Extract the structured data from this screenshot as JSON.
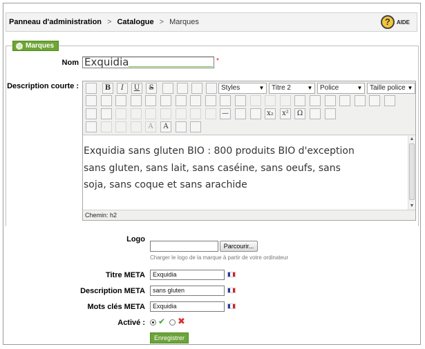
{
  "breadcrumb": {
    "items": [
      "Panneau d'administration",
      "Catalogue",
      "Marques"
    ],
    "separator": ">"
  },
  "help": {
    "label": "AIDE",
    "icon": "question-mark-icon"
  },
  "fieldset": {
    "legend": "Marques",
    "legend_icon": "gear-icon",
    "legend_color": "#6fa535"
  },
  "form": {
    "name": {
      "label": "Nom",
      "value": "Exquidia",
      "required_mark": "*"
    },
    "short_description": {
      "label": "Description courte :",
      "content": "Exquidia sans gluten BIO :  800 produits BIO d'exception sans gluten, sans lait, sans caséine, sans oeufs, sans soja, sans coque et sans arachide",
      "path_label": "Chemin: h2"
    },
    "toolbar": {
      "row1": [
        "new-document-icon",
        "bold-icon",
        "italic-icon",
        "underline-icon",
        "strikethrough-icon",
        "align-left-icon",
        "align-center-icon",
        "align-right-icon",
        "align-justify-icon"
      ],
      "row1_glyphs": [
        "",
        "B",
        "I",
        "U",
        "S",
        "",
        "",
        "",
        ""
      ],
      "dropdowns": [
        {
          "name": "styles",
          "value": "Styles"
        },
        {
          "name": "format",
          "value": "Titre 2"
        },
        {
          "name": "font",
          "value": "Police"
        },
        {
          "name": "font-size",
          "value": "Taille police"
        }
      ],
      "row2": [
        "cut-icon",
        "copy-icon",
        "paste-icon",
        "paste-text-icon",
        "paste-word-icon",
        "bullet-list-icon",
        "numbered-list-icon",
        "outdent-icon",
        "indent-icon",
        "blockquote-icon",
        "undo-icon",
        "redo-icon",
        "link-icon",
        "unlink-icon",
        "anchor-icon",
        "image-icon",
        "cleanup-icon",
        "help-icon",
        "code-icon",
        "text-color-icon",
        "background-color-icon"
      ],
      "row3": [
        "insert-date-icon",
        "table-icon",
        "table-props-icon",
        "insert-row-icon",
        "delete-row-icon",
        "split-cells-icon",
        "merge-cells-icon",
        "insert-col-icon",
        "delete-col-icon",
        "horizontal-rule-icon",
        "remove-format-icon",
        "visual-aid-icon",
        "subscript-icon",
        "superscript-icon",
        "special-char-icon",
        "media-icon",
        "fullscreen-icon"
      ],
      "row3_glyphs": [
        "",
        "",
        "",
        "",
        "",
        "",
        "",
        "",
        "",
        "—",
        "",
        "",
        "x₂",
        "x²",
        "Ω",
        "",
        ""
      ],
      "row4": [
        "style-props-icon",
        "cite-icon",
        "abbr-icon",
        "acronym-icon",
        "deletion-icon",
        "insertion-icon",
        "template-icon",
        "attributes-icon"
      ],
      "row4_glyphs": [
        "",
        "",
        "",
        "",
        "A",
        "A",
        "",
        ""
      ]
    },
    "logo": {
      "label": "Logo",
      "browse_label": "Parcourir...",
      "hint": "Charger le logo de la marque à partir de votre ordinateur"
    },
    "meta_title": {
      "label": "Titre META",
      "value": "Exquidia"
    },
    "meta_description": {
      "label": "Description META",
      "value": "sans gluten"
    },
    "meta_keywords": {
      "label": "Mots clés META",
      "value": "Exquidia"
    },
    "active": {
      "label": "Activé :",
      "selected": "yes"
    },
    "submit_label": "Enregistrer"
  },
  "colors": {
    "accent_green": "#6ca33a",
    "required_red": "#dd1111",
    "flag_blue": "#1d3f9c",
    "flag_white": "#ffffff",
    "flag_red": "#d81e2a"
  }
}
